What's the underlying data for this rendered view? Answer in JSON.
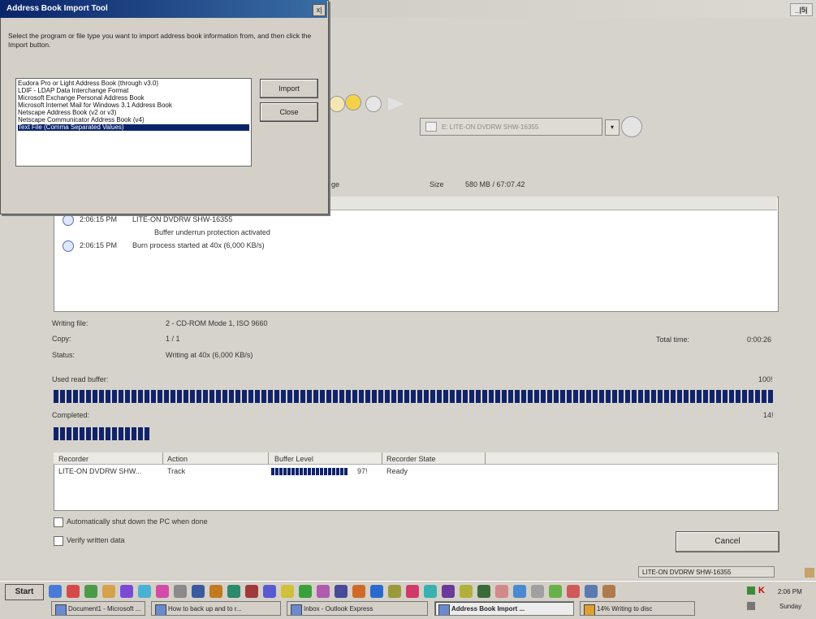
{
  "burn_window": {
    "size_label": "Size",
    "size_value": "580 MB / 67:07.42",
    "partial_label": "ge",
    "drive_combo_value": "E: LITE-ON DVDRW SHW-16355",
    "log": [
      {
        "time": "2:06:15 PM",
        "message": "LITE-ON DVDRW SHW-16355"
      },
      {
        "time": "",
        "message": "Buffer underrun protection activated"
      },
      {
        "time": "2:06:15 PM",
        "message": "Burn process started at 40x (6,000 KB/s)"
      }
    ],
    "info": {
      "writing_file_label": "Writing file:",
      "writing_file_value": "2 - CD-ROM Mode 1, ISO 9660",
      "copy_label": "Copy:",
      "copy_value": "1 / 1",
      "status_label": "Status:",
      "status_value": "Writing at 40x (6,000 KB/s)",
      "total_time_label": "Total time:",
      "total_time_value": "0:00:26"
    },
    "buffer": {
      "label": "Used read buffer:",
      "percent_text": "100!",
      "percent": 100
    },
    "completed": {
      "label": "Completed:",
      "percent_text": "14!",
      "percent": 14
    },
    "recorder_table": {
      "headers": [
        "Recorder",
        "Action",
        "Buffer Level",
        "Recorder State"
      ],
      "rows": [
        {
          "recorder": "LITE-ON DVDRW SHW...",
          "action": "Track",
          "buffer_text": "97!",
          "buffer_level": 97,
          "state": "Ready"
        }
      ]
    },
    "shutdown_label": "Automatically shut down the PC when done",
    "verify_label": "Verify written data",
    "cancel_label": "Cancel",
    "status_bar_text": "LITE-ON DVDRW SHW-16355",
    "window_buttons": "_|5|"
  },
  "dialog": {
    "title": "Address Book Import Tool",
    "close_glyph": "x|",
    "instructions": "Select the program or file type you want to import address book information from, and then click the Import button.",
    "options": [
      "Eudora Pro or Light Address Book (through v3.0)",
      "LDIF - LDAP Data Interchange Format",
      "Microsoft Exchange Personal Address Book",
      "Microsoft Internet Mail for Windows 3.1 Address Book",
      "Netscape Address Book (v2 or v3)",
      "Netscape Communicator Address Book (v4)",
      "Text File (Comma Separated Values)"
    ],
    "selected_index": 6,
    "import_label": "Import",
    "close_label": "Close"
  },
  "taskbar": {
    "start_label": "Start",
    "tasks": [
      {
        "label": "Document1 - Microsoft ...",
        "active": false
      },
      {
        "label": "How to back up and to r...",
        "active": false
      },
      {
        "label": "Inbox - Outlook Express",
        "active": false
      },
      {
        "label": "Address Book Import ...",
        "active": true
      },
      {
        "label": "14% Writing to disc",
        "active": false
      }
    ],
    "clock_time": "2:06 PM",
    "clock_day": "Sunday"
  },
  "colors": {
    "progress": "#11236b",
    "selection": "#0a246a",
    "title_gradient_start": "#0a246a",
    "title_gradient_end": "#3a6ea5"
  }
}
